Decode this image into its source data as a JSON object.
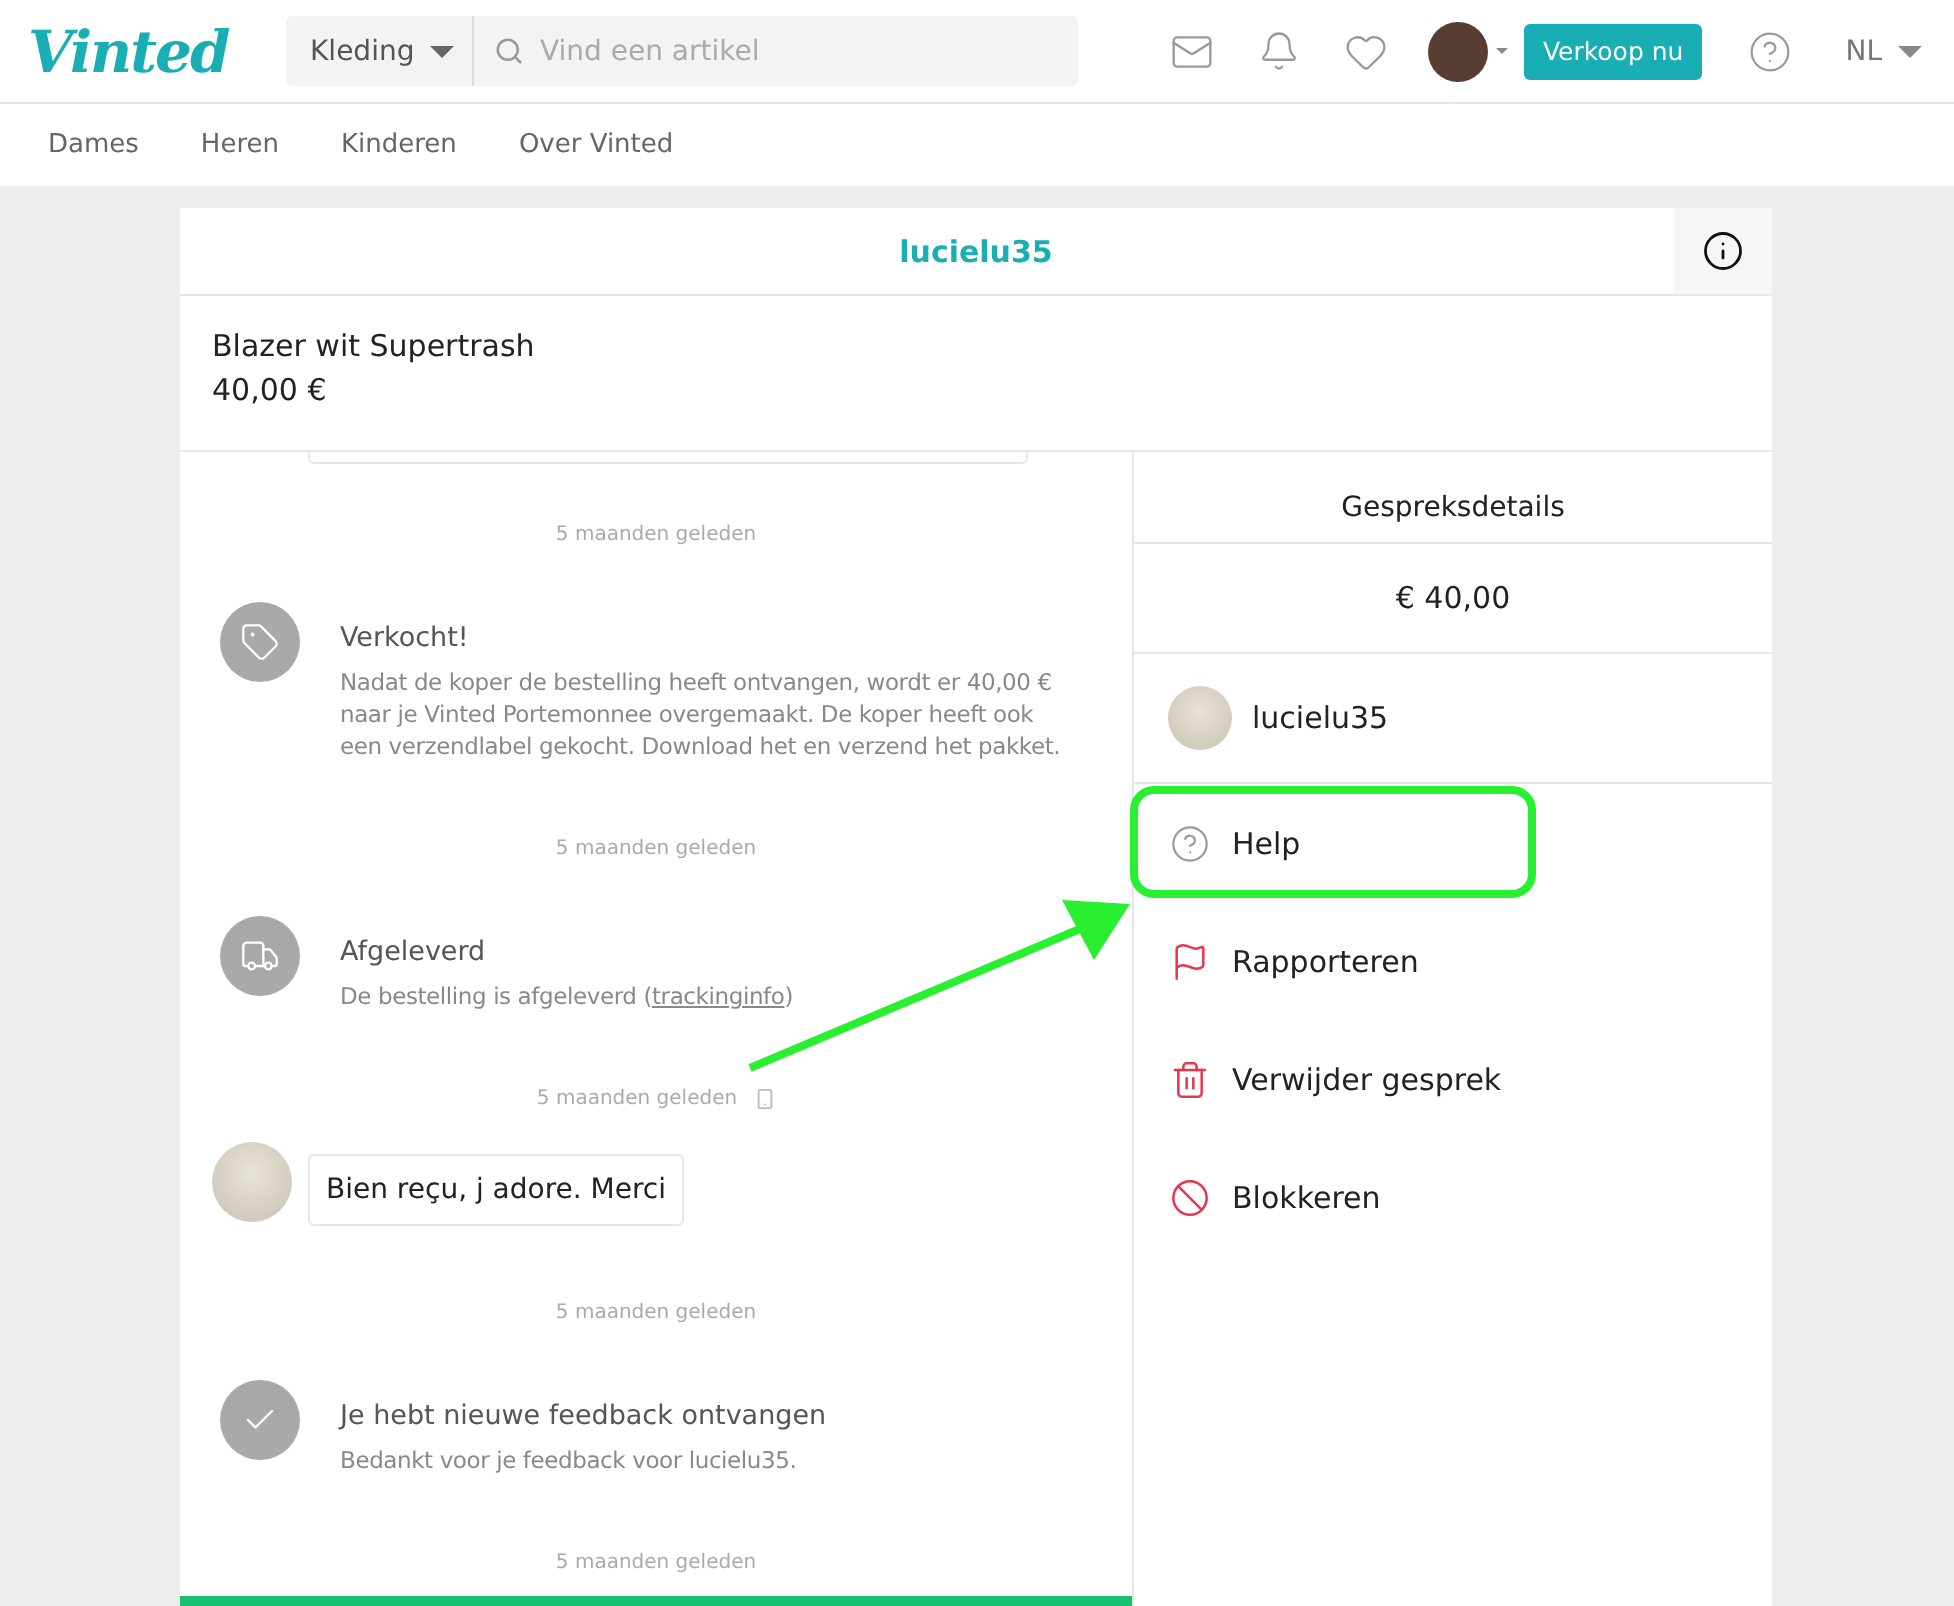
{
  "header": {
    "logo": "Vinted",
    "category": "Kleding",
    "search": {
      "placeholder": "Vind een artikel"
    },
    "sell_button": "Verkoop nu",
    "language": "NL"
  },
  "nav": [
    "Dames",
    "Heren",
    "Kinderen",
    "Over Vinted"
  ],
  "conversation": {
    "title": "lucielu35",
    "item": {
      "title": "Blazer wit Supertrash",
      "price": "40,00 €"
    },
    "timeline": [
      {
        "kind": "time",
        "text": "5 maanden geleden",
        "from_mobile": false
      },
      {
        "kind": "sold",
        "title": "Verkocht!",
        "body": "Nadat de koper de bestelling heeft ontvangen, wordt er 40,00 € naar je Vinted Portemonnee overgemaakt. De koper heeft ook een verzendlabel gekocht. Download het en verzend het pakket."
      },
      {
        "kind": "time",
        "text": "5 maanden geleden",
        "from_mobile": false
      },
      {
        "kind": "delivered",
        "title": "Afgeleverd",
        "body": "De bestelling is afgeleverd (",
        "link": "trackinginfo",
        "body_end": ")"
      },
      {
        "kind": "time",
        "text": "5 maanden geleden",
        "from_mobile": true
      },
      {
        "kind": "message",
        "text": "Bien reçu, j adore. Merci"
      },
      {
        "kind": "time",
        "text": "5 maanden geleden",
        "from_mobile": false
      },
      {
        "kind": "feedback",
        "title": "Je hebt nieuwe feedback ontvangen",
        "body": "Bedankt voor je feedback voor lucielu35."
      },
      {
        "kind": "time",
        "text": "5 maanden geleden",
        "from_mobile": false
      }
    ],
    "details": {
      "title": "Gespreksdetails",
      "price": "€ 40,00",
      "user": "lucielu35",
      "actions": [
        {
          "kind": "help",
          "label": "Help",
          "highlighted": true
        },
        {
          "kind": "report",
          "label": "Rapporteren",
          "highlighted": false
        },
        {
          "kind": "delete",
          "label": "Verwijder gesprek",
          "highlighted": false
        },
        {
          "kind": "block",
          "label": "Blokkeren",
          "highlighted": false
        }
      ]
    }
  }
}
